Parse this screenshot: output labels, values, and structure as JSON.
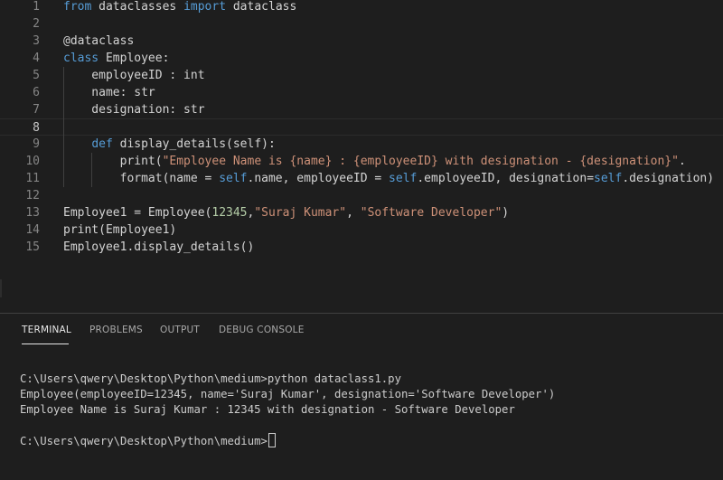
{
  "editor": {
    "lines": [
      {
        "num": "1",
        "tokens": [
          {
            "t": "from",
            "c": "kw"
          },
          {
            "t": " dataclasses ",
            "c": "plain"
          },
          {
            "t": "import",
            "c": "kw"
          },
          {
            "t": " dataclass",
            "c": "plain"
          }
        ]
      },
      {
        "num": "2",
        "tokens": []
      },
      {
        "num": "3",
        "tokens": [
          {
            "t": "@dataclass",
            "c": "plain"
          }
        ]
      },
      {
        "num": "4",
        "tokens": [
          {
            "t": "class",
            "c": "kw"
          },
          {
            "t": " Employee:",
            "c": "plain"
          }
        ]
      },
      {
        "num": "5",
        "tokens": [
          {
            "t": "    employeeID : int",
            "c": "plain"
          }
        ]
      },
      {
        "num": "6",
        "tokens": [
          {
            "t": "    name: str",
            "c": "plain"
          }
        ]
      },
      {
        "num": "7",
        "tokens": [
          {
            "t": "    designation: str",
            "c": "plain"
          }
        ]
      },
      {
        "num": "8",
        "tokens": [],
        "current": true
      },
      {
        "num": "9",
        "tokens": [
          {
            "t": "    ",
            "c": "plain"
          },
          {
            "t": "def",
            "c": "kw"
          },
          {
            "t": " display_details(self):",
            "c": "plain"
          }
        ]
      },
      {
        "num": "10",
        "tokens": [
          {
            "t": "        print(",
            "c": "plain"
          },
          {
            "t": "\"Employee Name is {name} : {employeeID} with designation - {designation}\"",
            "c": "str"
          },
          {
            "t": ".",
            "c": "plain"
          }
        ]
      },
      {
        "num": "11",
        "tokens": [
          {
            "t": "        format(name = ",
            "c": "plain"
          },
          {
            "t": "self",
            "c": "kw"
          },
          {
            "t": ".name, employeeID = ",
            "c": "plain"
          },
          {
            "t": "self",
            "c": "kw"
          },
          {
            "t": ".employeeID, designation=",
            "c": "plain"
          },
          {
            "t": "self",
            "c": "kw"
          },
          {
            "t": ".designation) )",
            "c": "plain"
          }
        ]
      },
      {
        "num": "12",
        "tokens": []
      },
      {
        "num": "13",
        "tokens": [
          {
            "t": "Employee1 = Employee(",
            "c": "plain"
          },
          {
            "t": "12345",
            "c": "num"
          },
          {
            "t": ",",
            "c": "plain"
          },
          {
            "t": "\"Suraj Kumar\"",
            "c": "str"
          },
          {
            "t": ", ",
            "c": "plain"
          },
          {
            "t": "\"Software Developer\"",
            "c": "str"
          },
          {
            "t": ")",
            "c": "plain"
          }
        ]
      },
      {
        "num": "14",
        "tokens": [
          {
            "t": "print(Employee1)",
            "c": "plain"
          }
        ]
      },
      {
        "num": "15",
        "tokens": [
          {
            "t": "Employee1.display_details()",
            "c": "plain"
          }
        ]
      }
    ]
  },
  "panel": {
    "tabs": [
      {
        "label": "TERMINAL",
        "active": true
      },
      {
        "label": "PROBLEMS",
        "active": false
      },
      {
        "label": "OUTPUT",
        "active": false
      },
      {
        "label": "DEBUG CONSOLE",
        "active": false
      }
    ]
  },
  "terminal": {
    "lines": [
      "C:\\Users\\qwery\\Desktop\\Python\\medium>python dataclass1.py",
      "Employee(employeeID=12345, name='Suraj Kumar', designation='Software Developer')",
      "Employee Name is Suraj Kumar : 12345 with designation - Software Developer",
      "",
      "C:\\Users\\qwery\\Desktop\\Python\\medium>"
    ]
  },
  "colors": {
    "keyword": "#569cd6",
    "string": "#ce9178",
    "number": "#b5cea8",
    "text": "#d4d4d4",
    "background": "#1e1e1e"
  }
}
